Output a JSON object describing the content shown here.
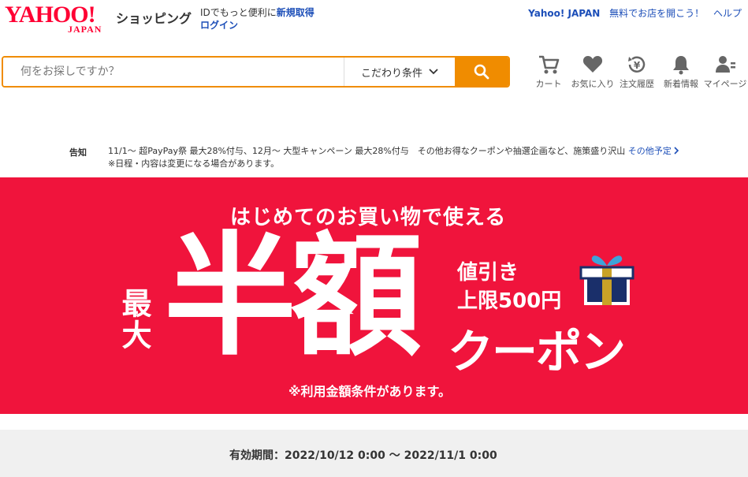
{
  "header": {
    "logo_main": "YAHOO!",
    "logo_sub": "JAPAN",
    "shop_name": "ショッピング",
    "id_text": "IDでもっと便利に",
    "register": "新規取得",
    "login": "ログイン",
    "yahoo_japan": "Yahoo! JAPAN",
    "open_shop": "無料でお店を開こう！",
    "help": "ヘルプ"
  },
  "search": {
    "placeholder": "何をお探しですか？",
    "conditions": "こだわり条件"
  },
  "nav": {
    "cart": "カート",
    "favorites": "お気に入り",
    "history": "注文履歴",
    "news": "新着情報",
    "mypage": "マイページ"
  },
  "notice": {
    "label": "告知",
    "line1": "11/1～ 超PayPay祭 最大28%付与、12月～ 大型キャンペーン 最大28%付与　その他お得なクーポンや抽選企画など、施策盛り沢山",
    "more": "その他予定",
    "line2": "※日程・内容は変更になる場合があります。"
  },
  "banner": {
    "top": "はじめてのお買い物で使える",
    "max": "最大",
    "big": "半額",
    "disc1": "値引き",
    "disc2": "上限500円",
    "coupon": "クーポン",
    "note": "※利用金額条件があります。",
    "color": "#f0143c"
  },
  "validity": {
    "text": "有効期間：2022/10/12 0:00 ～ 2022/11/1 0:00"
  }
}
